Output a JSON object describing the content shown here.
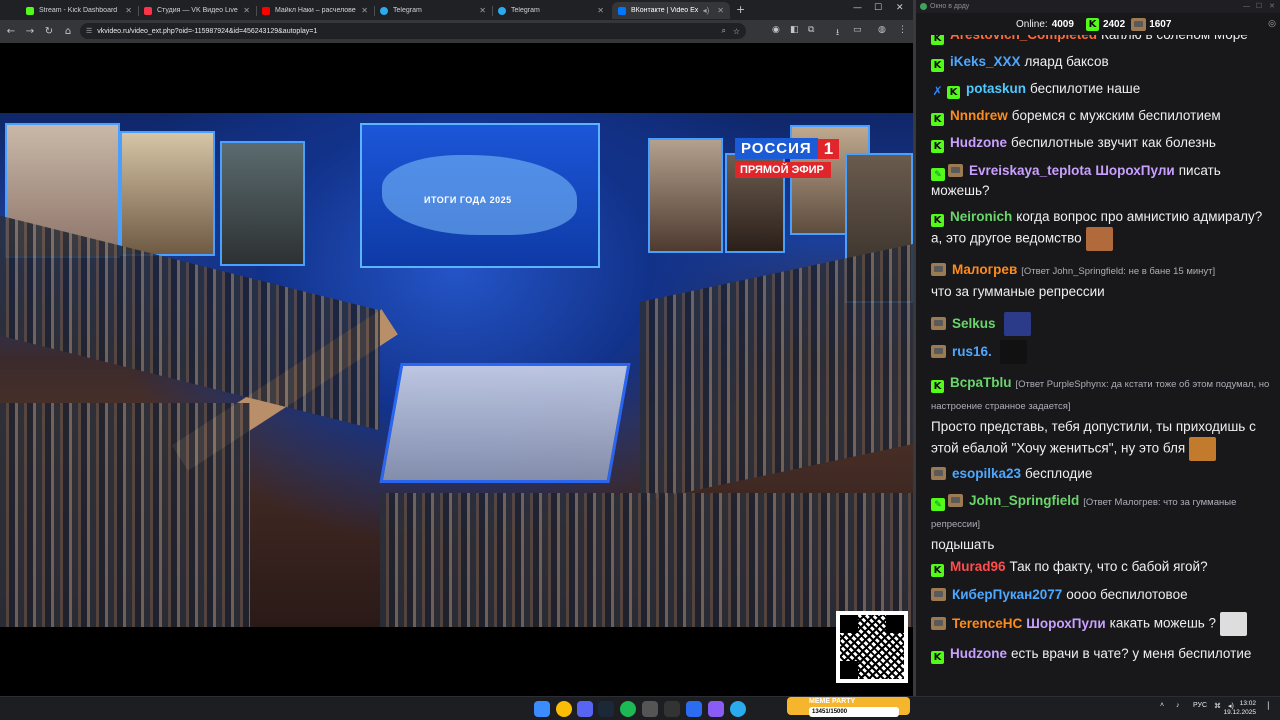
{
  "browser": {
    "tabs": [
      {
        "title": "Stream - Kick Dashboard",
        "icon": "kick-icon",
        "color": "#53fc18"
      },
      {
        "title": "Студия — VK Видео Live",
        "icon": "vk-video-icon",
        "color": "#ff3347"
      },
      {
        "title": "Майкл Наки – расчеловечива",
        "icon": "youtube-icon",
        "color": "#ff0000"
      },
      {
        "title": "Telegram",
        "icon": "telegram-icon",
        "color": "#2aabee"
      },
      {
        "title": "Telegram",
        "icon": "telegram-icon",
        "color": "#2aabee"
      },
      {
        "title": "ВКонтакте | Video Ext",
        "icon": "vk-icon",
        "color": "#0077ff"
      }
    ],
    "url": "vkvideo.ru/video_ext.php?oid=-115987924&id=456243129&autoplay=1"
  },
  "video": {
    "channel_logo_name": "РОССИЯ",
    "channel_logo_number": "1",
    "live_label": "ПРЯМОЙ ЭФИР",
    "screen_text": "ИТОГИ ГОДА 2025"
  },
  "chat": {
    "window_title": "Окно в дрду",
    "online_label": "Online:",
    "online_count": "4009",
    "kick_count": "2402",
    "vk_count": "1607",
    "messages": [
      {
        "badges": [
          "kick"
        ],
        "user": "Arestovich_Completed",
        "color": "#ff6b35",
        "text": "Каплю в соленом Море"
      },
      {
        "badges": [
          "kick"
        ],
        "user": "iKeks_XXX",
        "color": "#4ea8ff",
        "text": "ляард баксов"
      },
      {
        "badges": [
          "blue",
          "kick"
        ],
        "user": "potaskun",
        "color": "#4ec9ff",
        "text": "беспилотие наше"
      },
      {
        "badges": [
          "kick"
        ],
        "user": "Nnndrew",
        "color": "#ff8c1a",
        "text": "боремся с мужским беспилотием"
      },
      {
        "badges": [
          "kick"
        ],
        "user": "Hudzone",
        "color": "#c9a0ff",
        "text": "беспилотные звучит как болезнь"
      },
      {
        "badges": [
          "pen",
          "vk"
        ],
        "user": "Evreiskaya_teplota",
        "color": "#c9a0ff",
        "mention": "ШорохПули",
        "text": "писать можешь?"
      },
      {
        "badges": [
          "kick"
        ],
        "user": "Neironich",
        "color": "#6ad66a",
        "text": "когда вопрос про амнистию адмиралу? а, это другое ведомство"
      },
      {
        "badges": [
          "vk"
        ],
        "user": "Малогрев",
        "color": "#ff8c1a",
        "reply": "[Ответ John_Springfield: не в бане 15 минут]",
        "text": "что за гумманые репрессии"
      },
      {
        "badges": [
          "vk"
        ],
        "user": "Selkus",
        "color": "#6ad66a",
        "text": ""
      },
      {
        "badges": [
          "vk"
        ],
        "user": "rus16.",
        "color": "#4ea8ff",
        "text": ""
      },
      {
        "badges": [
          "kick"
        ],
        "user": "BcpaTblu",
        "color": "#6ad66a",
        "reply": "[Ответ PurpleSphynx: да кстати тоже об этом подумал, но настроение странное задается]",
        "text": "Просто представь, тебя допустили, ты приходишь с этой ебалой \"Хочу жениться\", ну это бля"
      },
      {
        "badges": [
          "vk"
        ],
        "user": "esopilka23",
        "color": "#4ea8ff",
        "text": "бесплодие"
      },
      {
        "badges": [
          "pen",
          "vk"
        ],
        "user": "John_Springfield",
        "color": "#6ad66a",
        "reply": "[Ответ Малогрев: что за гумманые репрессии]",
        "text": "подышать"
      },
      {
        "badges": [
          "kick"
        ],
        "user": "Murad96",
        "color": "#ff4d4d",
        "text": "Так по факту, что с бабой ягой?"
      },
      {
        "badges": [
          "vk"
        ],
        "user": "КиберПукан2077",
        "color": "#4ea8ff",
        "text": "оооо беспилотовое"
      },
      {
        "badges": [
          "vk"
        ],
        "user": "TerenceHC",
        "color": "#ff8c1a",
        "mention": "ШорохПули",
        "text": "какать можешь ?"
      },
      {
        "badges": [
          "kick"
        ],
        "user": "Hudzone",
        "color": "#c9a0ff",
        "text": "есть врачи в чате? у меня беспилотие"
      }
    ]
  },
  "taskbar": {
    "meme_title": "MEME PARTY",
    "meme_sub": "13451/15000",
    "lang": "РУС",
    "time": "13:02",
    "date": "19.12.2025"
  }
}
